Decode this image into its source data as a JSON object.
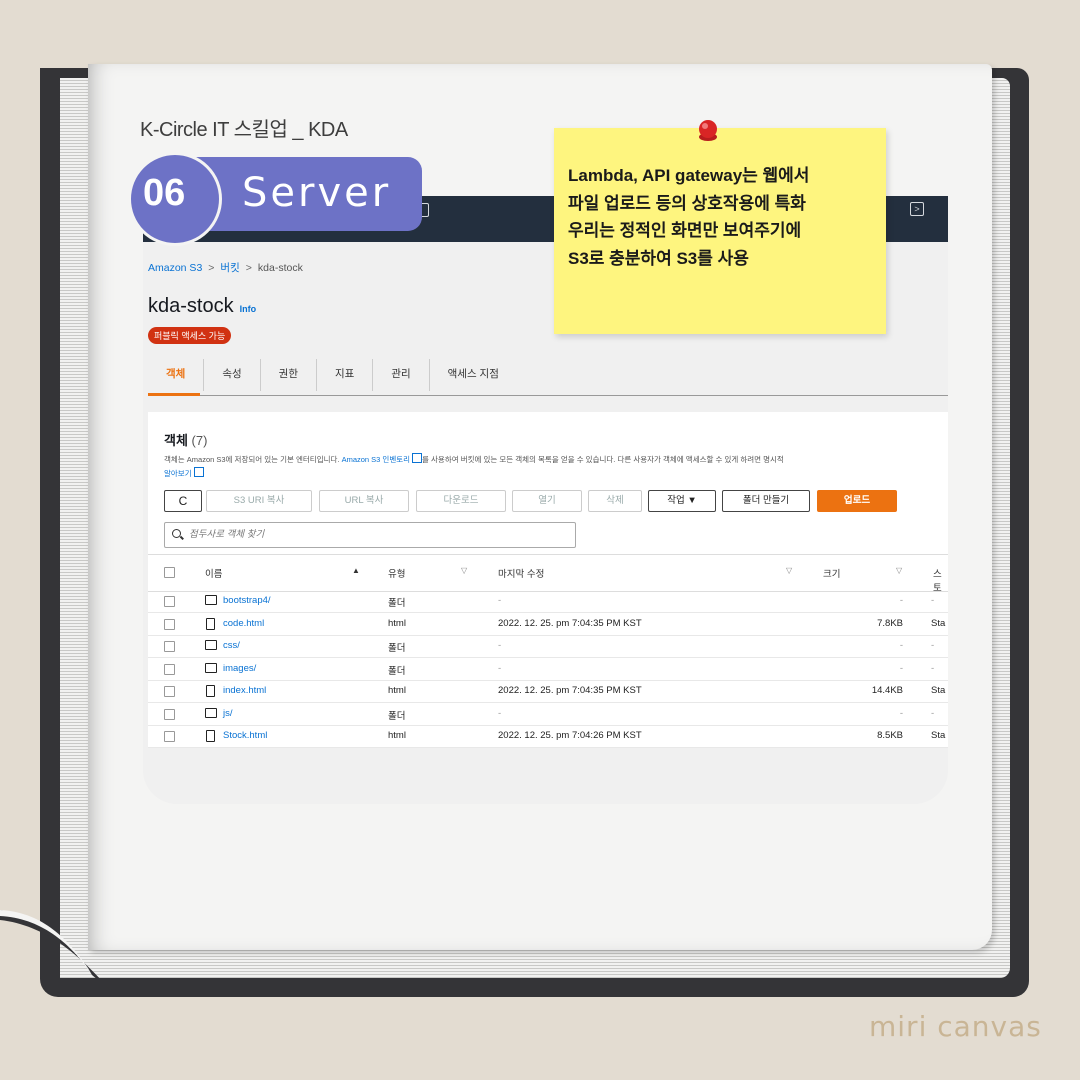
{
  "heading": "K-Circle IT 스킬업 _ KDA",
  "section": {
    "number": "06",
    "label": "Server"
  },
  "note": {
    "text": "Lambda, API gateway는 웹에서\n파일 업로드 등의 상호작용에 특화\n우리는 정적인 화면만 보여주기에\nS3로 충분하여 S3를 사용"
  },
  "brand": "miri canvas",
  "s3": {
    "breadcrumb": [
      "Amazon S3",
      "버킷",
      "kda-stock"
    ],
    "bucket_name": "kda-stock",
    "info": "Info",
    "public_badge": "퍼블릭 액세스 가능",
    "tabs": [
      "객체",
      "속성",
      "권한",
      "지표",
      "관리",
      "액세스 지점"
    ],
    "objects_title": "객체",
    "objects_count": "(7)",
    "desc_1": "객체는 Amazon S3에 저장되어 있는 기본 엔터티입니다. ",
    "desc_link": "Amazon S3 인벤토리",
    "desc_2": "를 사용하여 버킷에 있는 모든 객체의 목록을 얻을 수 있습니다. 다른 사용자가 객체에 액세스할 수 있게 하려면 명시적",
    "learn_more": "알아보기",
    "toolbar": {
      "refresh": "C",
      "copy_s3_uri": "S3 URI 복사",
      "copy_url": "URL 복사",
      "download": "다운로드",
      "open": "열기",
      "delete": "삭제",
      "actions": "작업 ▼",
      "create_folder": "폴더 만들기",
      "upload": "업로드"
    },
    "search_placeholder": "접두사로 객체 찾기",
    "columns": [
      "이름",
      "유형",
      "마지막 수정",
      "크기",
      "스토"
    ],
    "rows": [
      {
        "icon": "folder-icon",
        "name": "bootstrap4/",
        "type": "폴더",
        "modified": "-",
        "size": "-",
        "storage": "-"
      },
      {
        "icon": "file-icon",
        "name": "code.html",
        "type": "html",
        "modified": "2022. 12. 25. pm 7:04:35 PM KST",
        "size": "7.8KB",
        "storage": "Sta"
      },
      {
        "icon": "folder-icon",
        "name": "css/",
        "type": "폴더",
        "modified": "-",
        "size": "-",
        "storage": "-"
      },
      {
        "icon": "folder-icon",
        "name": "images/",
        "type": "폴더",
        "modified": "-",
        "size": "-",
        "storage": "-"
      },
      {
        "icon": "file-icon",
        "name": "index.html",
        "type": "html",
        "modified": "2022. 12. 25. pm 7:04:35 PM KST",
        "size": "14.4KB",
        "storage": "Sta"
      },
      {
        "icon": "folder-icon",
        "name": "js/",
        "type": "폴더",
        "modified": "-",
        "size": "-",
        "storage": "-"
      },
      {
        "icon": "file-icon",
        "name": "Stock.html",
        "type": "html",
        "modified": "2022. 12. 25. pm 7:04:26 PM KST",
        "size": "8.5KB",
        "storage": "Sta"
      }
    ]
  }
}
